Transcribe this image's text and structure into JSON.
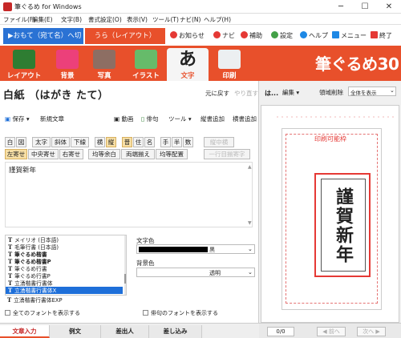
{
  "window": {
    "title": "筆ぐるめ for Windows"
  },
  "menu": [
    "ファイル(F)",
    "編集(E)",
    "文字(B)",
    "書式設定(O)",
    "表示(V)",
    "ツール(T)",
    "ナビ(N)",
    "ヘルプ(H)"
  ],
  "mode_tabs": {
    "omote": "▶おもて（宛て名）へ切替",
    "ura": "うら（レイアウト）"
  },
  "header_buttons": {
    "notice": "お知らせ",
    "navi": "ナビ",
    "assist": "補助",
    "settings": "設定",
    "help": "ヘルプ",
    "menu": "メニュー",
    "exit": "終了"
  },
  "ribbon": {
    "tabs": [
      "レイアウト",
      "背景",
      "写真",
      "イラスト",
      "文字",
      "印刷"
    ],
    "active": "文字",
    "brand": "筆ぐるめ30"
  },
  "document": {
    "title": "白紙 （はがき たて）",
    "undo": "元に戻す",
    "redo": "やり直す"
  },
  "toolbar": {
    "save": "保存",
    "new_text": "新規文章",
    "video": "動画",
    "haiku": "俳句",
    "tools": "ツール",
    "vertical_add": "縦書追加",
    "horizontal_add": "横書追加"
  },
  "format_row1": [
    "白",
    "図",
    "太字",
    "斜体",
    "下線",
    "横",
    "縦",
    "普",
    "住",
    "名",
    "手",
    "半",
    "数",
    "縦中横"
  ],
  "format_row2": [
    "左寄せ",
    "中央寄せ",
    "右寄せ",
    "均等余白",
    "両端揃え",
    "均等配置",
    "一行目揃寄字"
  ],
  "text_content": "謹賀新年",
  "fonts": [
    "メイリオ (日本語)",
    "毛筆行書 (日本語)",
    "筆ぐるめ楷書",
    "筆ぐるめ楷書P",
    "筆ぐるめ行書",
    "筆ぐるめ行書P",
    "立湧楷書行書体",
    "立湧楷書行書体X",
    "立湧楷書行書体EXP"
  ],
  "selected_font_index": 7,
  "show_all_fonts": "全てのフォントを表示する",
  "show_haiku_fonts": "俳句のフォントを表示する",
  "text_color": {
    "label": "文字色",
    "value": "黒"
  },
  "bg_color": {
    "label": "背景色",
    "value": "透明"
  },
  "bottom_tabs": [
    "文章入力",
    "例文",
    "差出人",
    "差し込み"
  ],
  "right_toolbar": {
    "label": "は...",
    "edit": "編集",
    "region_delete": "領域削除",
    "zoom": "全体を表示"
  },
  "preview": {
    "print_area": "印刷可能枠",
    "vertical_text": "謹賀新年"
  },
  "status": {
    "page": "0/0",
    "prev": "前へ",
    "next": "次へ"
  }
}
